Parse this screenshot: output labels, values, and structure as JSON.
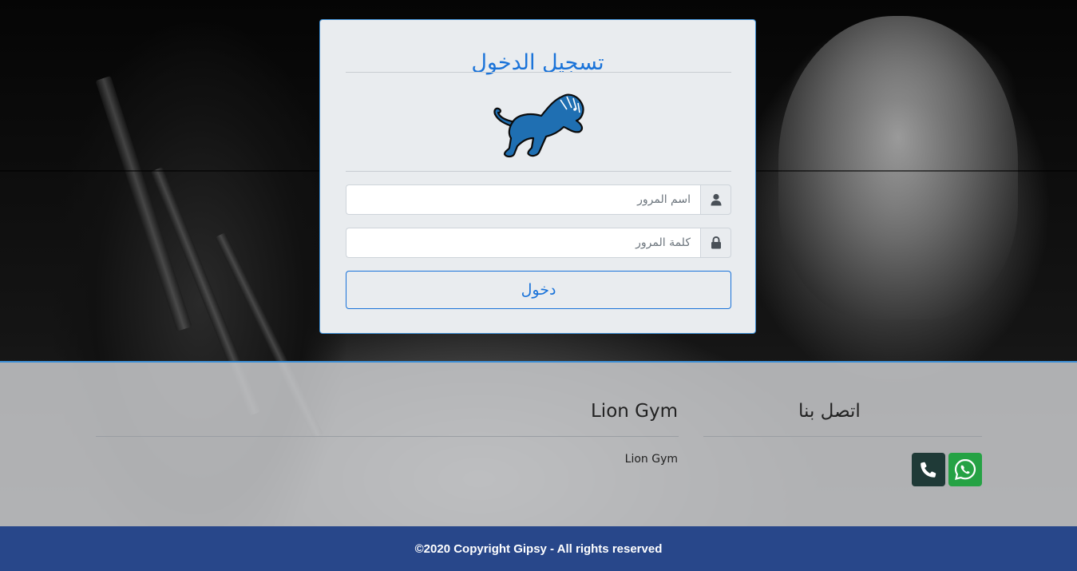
{
  "login": {
    "title": "تسجيل الدخول",
    "username_placeholder": "اسم المرور",
    "password_placeholder": "كلمة المرور",
    "submit_label": "دخول"
  },
  "footer": {
    "contact": {
      "heading": "اتصل بنا",
      "icons": [
        "phone-icon",
        "whatsapp-icon"
      ]
    },
    "about": {
      "heading": "Lion Gym",
      "text": "Lion Gym"
    },
    "copyright": "©2020 Copyright Gipsy - All rights reserved"
  },
  "colors": {
    "accent": "#1a73d9",
    "card_background": "#e9ecef",
    "footer_bar": "#28478a",
    "phone_button": "#1f3a37",
    "whatsapp_button": "#25a244",
    "lion_blue": "#1f6fb2"
  }
}
